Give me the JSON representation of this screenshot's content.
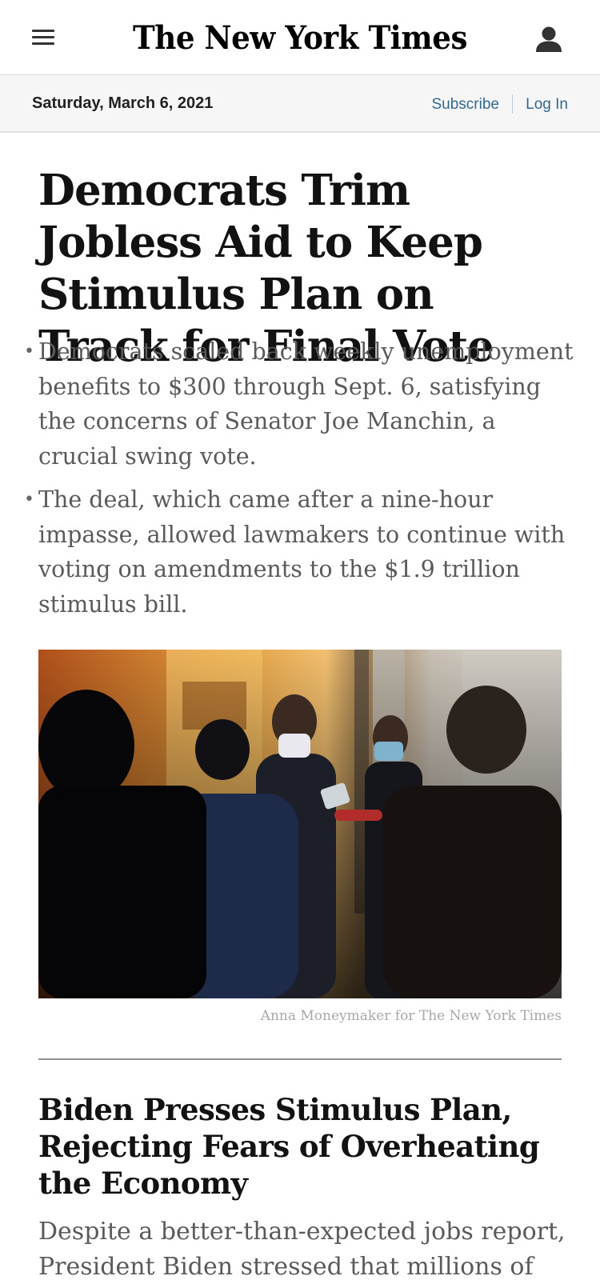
{
  "header": {
    "masthead": "The New York Times",
    "menu_icon": "hamburger-menu-icon",
    "account_icon": "user-account-icon"
  },
  "datebar": {
    "date": "Saturday, March 6, 2021",
    "subscribe_label": "Subscribe",
    "login_label": "Log In"
  },
  "lead_story": {
    "headline": "Democrats Trim Jobless Aid to Keep Stimulus Plan on Track for Final Vote",
    "summary": [
      "Democrats scaled back weekly unemployment benefits to $300 through Sept. 6, satisfying the concerns of Senator Joe Manchin, a crucial swing vote.",
      "The deal, which came after a nine-hour impasse, allowed lawmakers to continue with voting on amendments to the $1.9 trillion stimulus bill."
    ],
    "photo_credit": "Anna Moneymaker for The New York Times"
  },
  "second_story": {
    "headline": "Biden Presses Stimulus Plan, Rejecting Fears of Overheating the Economy",
    "summary": "Despite a better-than-expected jobs report, President Biden stressed that millions of"
  },
  "colors": {
    "link": "#326891",
    "summary_text": "#5a5a5a",
    "datebar_bg": "#f6f6f6"
  }
}
